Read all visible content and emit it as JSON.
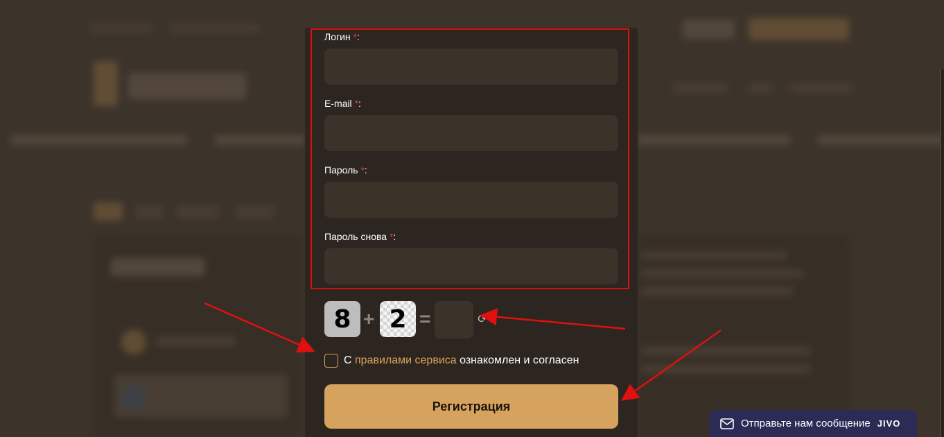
{
  "form": {
    "login_label": "Логин",
    "email_label": "E-mail",
    "password_label": "Пароль",
    "password_repeat_label": "Пароль снова",
    "required_mark": "*",
    "label_suffix": ":"
  },
  "captcha": {
    "first_digit": "8",
    "operator": "+",
    "second_digit": "2",
    "equals": "=",
    "refresh_glyph": "⟳"
  },
  "agreement": {
    "prefix": "С",
    "link_text": "правилами сервиса",
    "suffix": "ознакомлен и согласен"
  },
  "submit_label": "Регистрация",
  "chat": {
    "text": "Отправьте нам сообщение",
    "brand": "JIVO",
    "icon": "envelope-icon"
  },
  "colors": {
    "modal_bg": "#2d2620",
    "input_bg": "#3b332a",
    "accent": "#d6a35f",
    "highlight": "#d81010",
    "required": "#d64040"
  }
}
